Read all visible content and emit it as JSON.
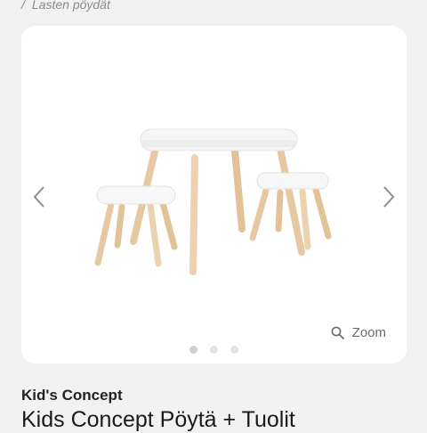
{
  "breadcrumb": {
    "separator": "/",
    "current": "Lasten pöydät"
  },
  "gallery": {
    "image_alt": "Kids Concept Pöytä + Tuolit",
    "prev_icon": "chevron-left-icon",
    "next_icon": "chevron-right-icon",
    "zoom_label": "Zoom",
    "zoom_icon": "magnifier-icon",
    "slides_total": 3,
    "active_slide": 1
  },
  "product": {
    "brand": "Kid's Concept",
    "title": "Kids Concept Pöytä + Tuolit"
  },
  "colors": {
    "background": "#f2f2f2",
    "card": "#ffffff",
    "text": "#1a1a1a",
    "muted": "#8a8a8a"
  }
}
